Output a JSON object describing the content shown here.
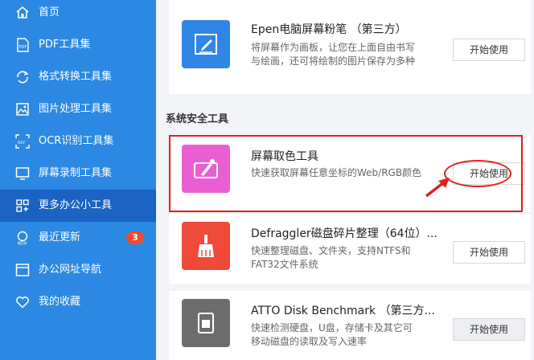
{
  "sidebar": {
    "items": [
      {
        "label": "首页",
        "icon": "home-icon"
      },
      {
        "label": "PDF工具集",
        "icon": "pdf-icon"
      },
      {
        "label": "格式转换工具集",
        "icon": "convert-icon"
      },
      {
        "label": "图片处理工具集",
        "icon": "image-icon"
      },
      {
        "label": "OCR识别工具集",
        "icon": "ocr-icon"
      },
      {
        "label": "屏幕录制工具集",
        "icon": "monitor-icon"
      },
      {
        "label": "更多办公小工具",
        "icon": "grid-icon"
      },
      {
        "label": "最近更新",
        "icon": "new-icon",
        "badge": "3"
      },
      {
        "label": "办公网址导航",
        "icon": "browser-icon"
      },
      {
        "label": "我的收藏",
        "icon": "heart-icon"
      }
    ],
    "active_index": 6
  },
  "main": {
    "section_title": "系统安全工具",
    "apps": [
      {
        "title": "Epen电脑屏幕粉笔 （第三方）",
        "desc_line1": "将屏幕作为画板，让您在上面自由书写",
        "desc_line2": "与绘画，还可将绘制的图片保存为多种",
        "button": "开始使用",
        "icon": "pen-icon",
        "color": "#2f86e6"
      },
      {
        "title": "屏幕取色工具",
        "desc_line1": "快速获取屏幕任意坐标的Web/RGB颜色",
        "desc_line2": "",
        "button": "开始使用",
        "icon": "color-picker-icon",
        "color": "#e95fd3"
      },
      {
        "title": "Defraggler磁盘碎片整理（64位）...",
        "desc_line1": "快速整理磁盘、文件夹，支持NTFS和",
        "desc_line2": "FAT32文件系统",
        "button": "开始使用",
        "icon": "broom-icon",
        "color": "#f04a3a"
      },
      {
        "title": "ATTO Disk Benchmark （第三方...",
        "desc_line1": "快速检测硬盘，U盘，存储卡及其它可",
        "desc_line2": "移动磁盘的读取及写入速率",
        "button": "开始使用",
        "icon": "disk-icon",
        "color": "#6d6d6d"
      }
    ]
  },
  "colors": {
    "sidebar_bg": "#2b88e3",
    "sidebar_active": "#1a63c2",
    "annotation_red": "#e01f1f"
  }
}
